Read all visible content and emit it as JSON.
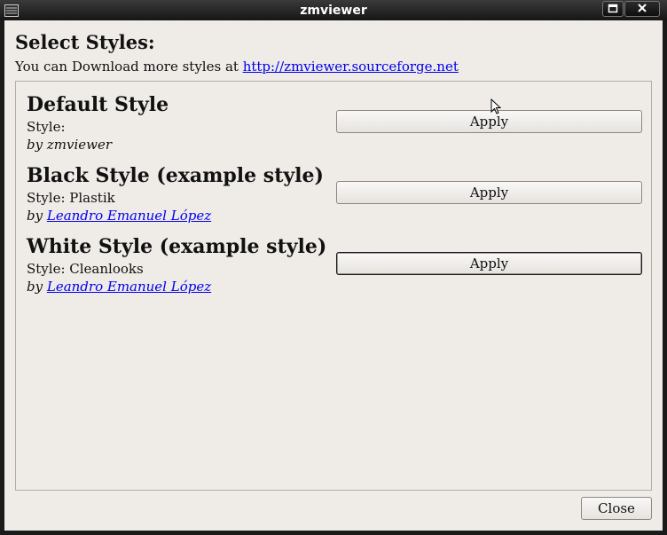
{
  "window": {
    "title": "zmviewer"
  },
  "dialog": {
    "heading": "Select Styles:",
    "download_prefix": "You can Download more styles at ",
    "download_link": "http://zmviewer.sourceforge.net"
  },
  "styles": [
    {
      "name": "Default Style",
      "style_line": "Style:",
      "by_prefix": "by ",
      "author": "zmviewer",
      "author_is_link": false,
      "apply_label": "Apply"
    },
    {
      "name": "Black Style (example style)",
      "style_line": "Style: Plastik",
      "by_prefix": "by ",
      "author": "Leandro Emanuel López",
      "author_is_link": true,
      "apply_label": "Apply"
    },
    {
      "name": "White Style (example style)",
      "style_line": "Style: Cleanlooks",
      "by_prefix": "by ",
      "author": "Leandro Emanuel López",
      "author_is_link": true,
      "apply_label": "Apply"
    }
  ],
  "footer": {
    "close_label": "Close"
  },
  "icons": {
    "window_menu": "window-menu-icon",
    "maximize": "maximize-icon",
    "close": "close-icon",
    "cursor": "mouse-cursor-icon"
  },
  "colors": {
    "window_bg": "#efebe7",
    "link": "#0000ee",
    "titlebar": "#161616"
  }
}
